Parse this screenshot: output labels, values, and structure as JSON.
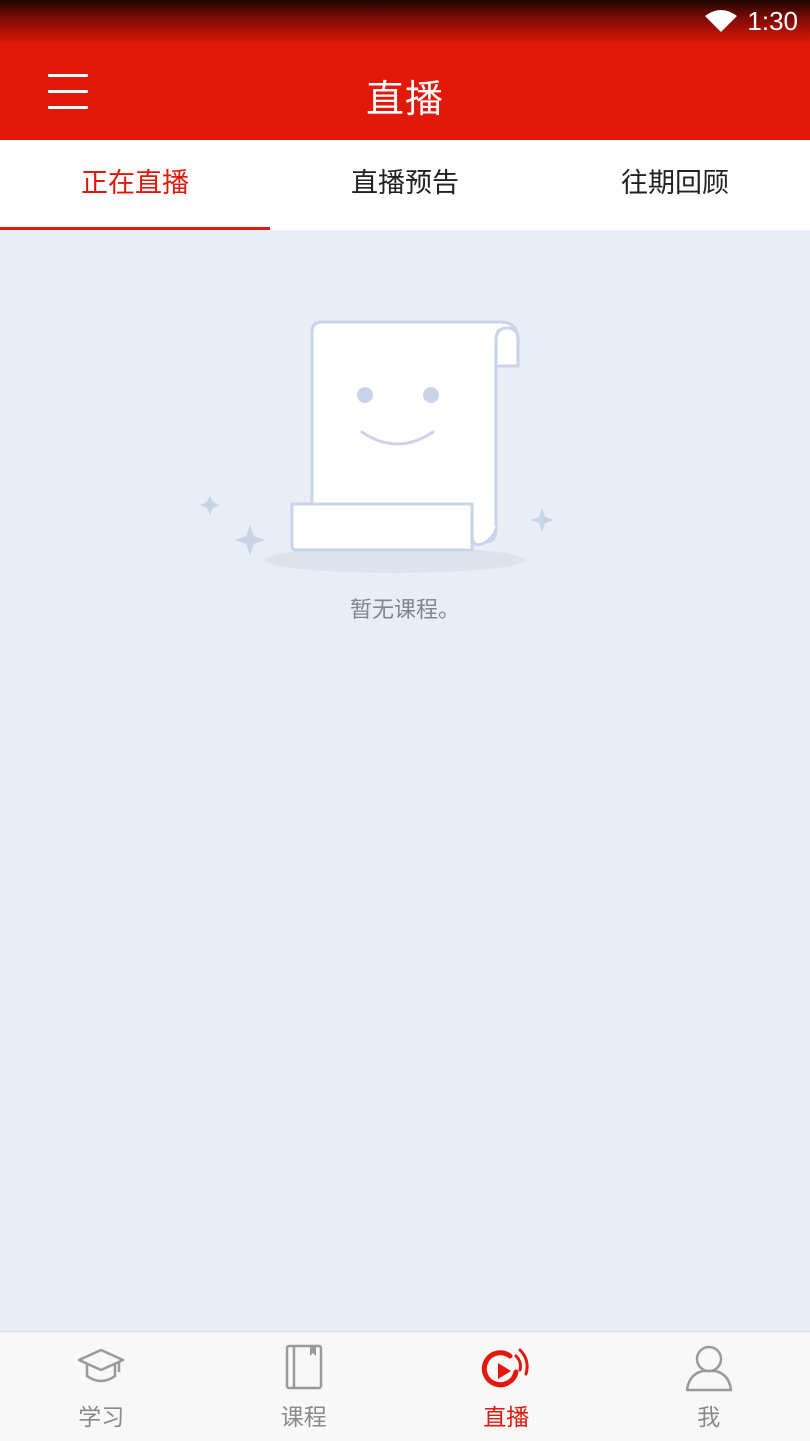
{
  "status_bar": {
    "time": "1:30",
    "wifi_icon": "wifi-icon"
  },
  "app_bar": {
    "title": "直播",
    "menu_icon": "menu-icon"
  },
  "tabs": [
    {
      "label": "正在直播",
      "active": true
    },
    {
      "label": "直播预告",
      "active": false
    },
    {
      "label": "往期回顾",
      "active": false
    }
  ],
  "empty_state": {
    "message": "暂无课程。",
    "illustration_icon": "empty-scroll-smiley-icon"
  },
  "bottom_nav": [
    {
      "label": "学习",
      "icon": "graduation-cap-icon",
      "active": false
    },
    {
      "label": "课程",
      "icon": "book-icon",
      "active": false
    },
    {
      "label": "直播",
      "icon": "live-broadcast-icon",
      "active": true
    },
    {
      "label": "我",
      "icon": "user-icon",
      "active": false
    }
  ],
  "colors": {
    "brand_red": "#e2180a",
    "background": "#e9eef6",
    "inactive_gray": "#8a8a8a"
  }
}
